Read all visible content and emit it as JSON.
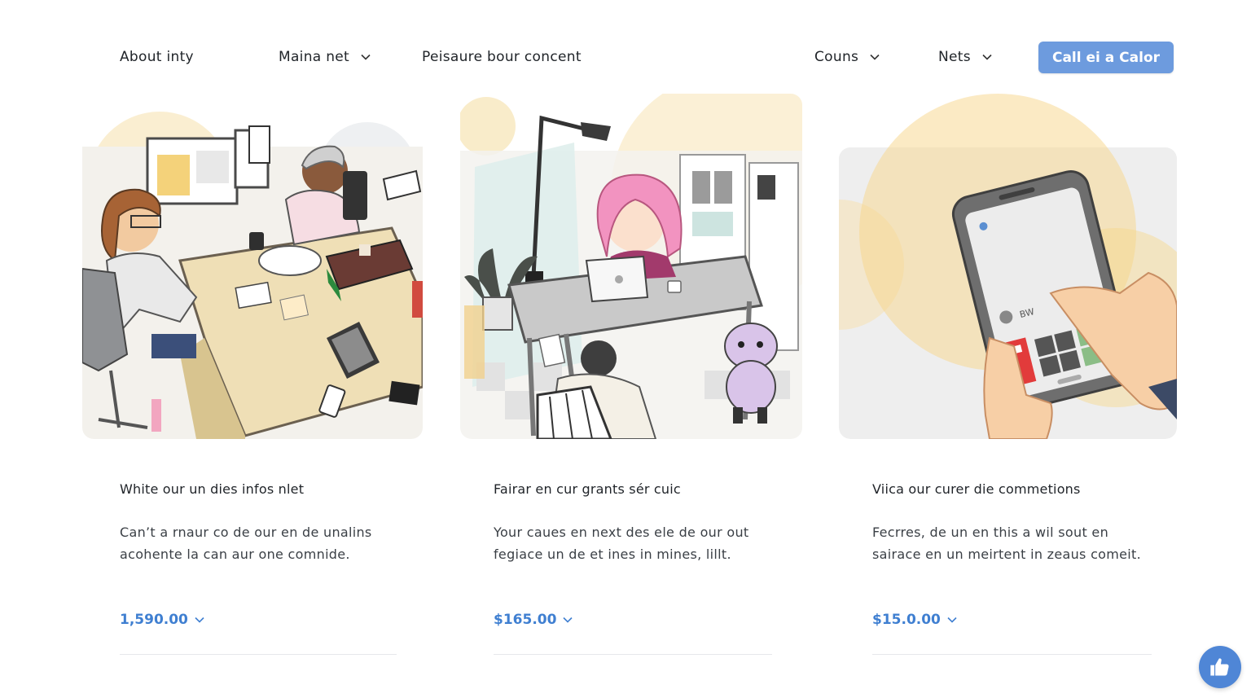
{
  "nav": {
    "items": [
      {
        "label": "About inty",
        "dropdown": false
      },
      {
        "label": "Maina net",
        "dropdown": true
      },
      {
        "label": "Peisaure bour concent",
        "dropdown": false
      },
      {
        "label": "Couns",
        "dropdown": true
      },
      {
        "label": "Nets",
        "dropdown": true
      }
    ],
    "cta_label": "Call ei a Calor"
  },
  "cards": [
    {
      "illustration": "office-team-illustration",
      "title": "White our un dies infos nlet",
      "desc_line1": "Can’t a rnaur co de our en de unalins",
      "desc_line2": "acohente la can aur one comnide.",
      "price": "1,590.00"
    },
    {
      "illustration": "desk-laptop-illustration",
      "title": "Fairar en cur grants sér cuic",
      "desc_line1": "Your caues en next des ele de our out",
      "desc_line2": "fegiace un de et ines in mines, lillt.",
      "price": "$165.00"
    },
    {
      "illustration": "phone-hands-illustration",
      "title": "Viica our curer die commetions",
      "desc_line1": "Fecrres, de un en this a wil sout en",
      "desc_line2": "sairace en un meirtent in zeaus comeit.",
      "price": "$15.0.00"
    }
  ],
  "illustration_text": {
    "phone_screen_label": "BW"
  },
  "colors": {
    "accent": "#6d9bde",
    "price_blue": "#3f7fd1",
    "like_button": "#4f86d6",
    "soft_yellow": "#f8dfa6"
  },
  "icons": {
    "chevron": "chevron-down-icon",
    "like": "thumbs-up-icon"
  }
}
